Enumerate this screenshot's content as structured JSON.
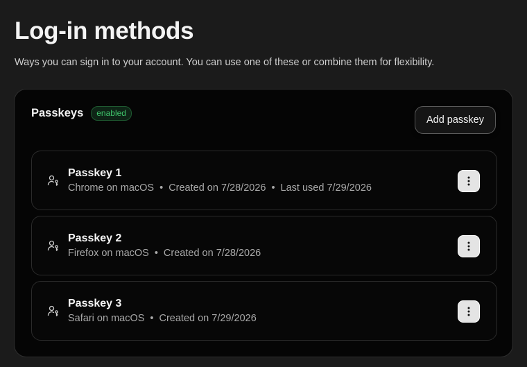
{
  "header": {
    "title": "Log-in methods",
    "subtitle": "Ways you can sign in to your account. You can use one of these or combine them for flexibility."
  },
  "passkeys_card": {
    "title": "Passkeys",
    "status_badge": "enabled",
    "add_button_label": "Add passkey",
    "icons": {
      "item_icon": "user-key-icon",
      "menu_icon": "more-vertical-icon"
    },
    "colors": {
      "badge_text": "#3fc46b",
      "card_background": "#050505",
      "page_background": "#1b1b1b"
    },
    "items": [
      {
        "name": "Passkey 1",
        "browser": "Chrome on macOS",
        "created": "Created on 7/28/2026",
        "last_used": "Last used 7/29/2026"
      },
      {
        "name": "Passkey 2",
        "browser": "Firefox on macOS",
        "created": "Created on 7/28/2026"
      },
      {
        "name": "Passkey 3",
        "browser": "Safari on macOS",
        "created": "Created on 7/29/2026"
      }
    ]
  }
}
